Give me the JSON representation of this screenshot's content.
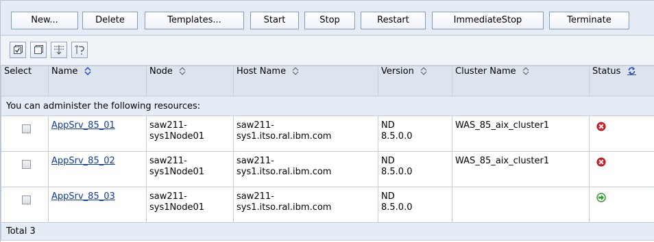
{
  "toolbar": {
    "buttons": [
      "New...",
      "Delete",
      "Templates...",
      "Start",
      "Stop",
      "Restart",
      "ImmediateStop",
      "Terminate"
    ]
  },
  "icon_toolbar": {
    "icons": [
      "select-all-icon",
      "deselect-all-icon",
      "show-filter-icon",
      "clear-filter-icon"
    ]
  },
  "table": {
    "headers": {
      "select": "Select",
      "name": "Name",
      "node": "Node",
      "host": "Host Name",
      "version": "Version",
      "cluster": "Cluster Name",
      "status": "Status"
    },
    "info_text": "You can administer the following resources:",
    "rows": [
      {
        "name": "AppSrv_85_01",
        "node": "saw211-sys1Node01",
        "node_l1": "saw211-",
        "node_l2": "sys1Node01",
        "host_l1": "saw211-",
        "host_l2": "sys1.itso.ral.ibm.com",
        "ver_l1": "ND",
        "ver_l2": "8.5.0.0",
        "cluster": "WAS_85_aix_cluster1",
        "status": "stopped",
        "status_color": "#d9232e"
      },
      {
        "name": "AppSrv_85_02",
        "node": "saw211-sys1Node01",
        "node_l1": "saw211-",
        "node_l2": "sys1Node01",
        "host_l1": "saw211-",
        "host_l2": "sys1.itso.ral.ibm.com",
        "ver_l1": "ND",
        "ver_l2": "8.5.0.0",
        "cluster": "WAS_85_aix_cluster1",
        "status": "stopped",
        "status_color": "#d9232e"
      },
      {
        "name": "AppSrv_85_03",
        "node": "saw211-sys1Node01",
        "node_l1": "saw211-",
        "node_l2": "sys1Node01",
        "host_l1": "saw211-",
        "host_l2": "sys1.itso.ral.ibm.com",
        "ver_l1": "ND",
        "ver_l2": "8.5.0.0",
        "cluster": "",
        "status": "started",
        "status_color": "#2e9e2e"
      }
    ],
    "total": "Total 3"
  },
  "colors": {
    "link": "#0b3aa8",
    "header_bg": "#dde4ee",
    "toolbar_bg": "#e6ecf5"
  }
}
